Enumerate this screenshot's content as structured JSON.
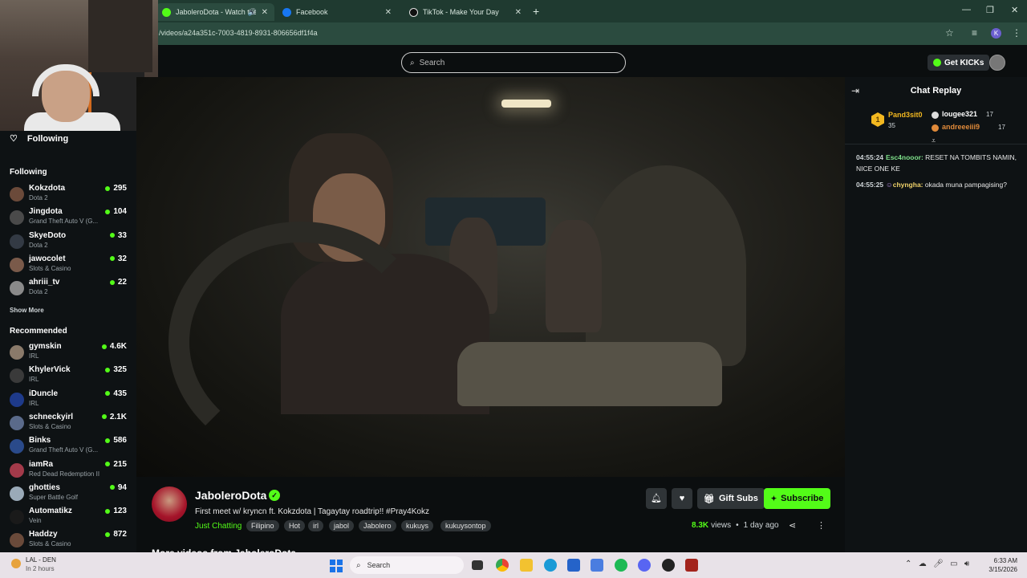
{
  "browser": {
    "tabs": [
      {
        "label": "JaboleroDota - Watch the V",
        "icon": "kick-icon",
        "active": true
      },
      {
        "label": "Facebook",
        "icon": "facebook-icon",
        "active": false
      },
      {
        "label": "TikTok - Make Your Day",
        "icon": "tiktok-icon",
        "active": false
      }
    ],
    "new_tab": "+",
    "window_controls": {
      "minimize": "—",
      "restore": "❐",
      "close": "✕"
    },
    "url": "/videos/a24a351c-7003-4819-8931-806656df1f4a",
    "profile_initial": "K"
  },
  "header": {
    "search_placeholder": "Search",
    "get_kicks_label": "Get KICKs"
  },
  "sidebar": {
    "following_nav_label": "Following",
    "following_title": "Following",
    "following": [
      {
        "name": "Kokzdota",
        "category": "Dota 2",
        "viewers": "295",
        "color": "#6b4a3a"
      },
      {
        "name": "Jingdota",
        "category": "Grand Theft Auto V (G...",
        "viewers": "104",
        "color": "#4a4a4a"
      },
      {
        "name": "SkyeDoto",
        "category": "Dota 2",
        "viewers": "33",
        "color": "#333a44"
      },
      {
        "name": "jawocolet",
        "category": "Slots & Casino",
        "viewers": "32",
        "color": "#7a5a4a"
      },
      {
        "name": "ahriii_tv",
        "category": "Dota 2",
        "viewers": "22",
        "color": "#8a8a8a"
      }
    ],
    "show_more_1": "Show More",
    "recommended_title": "Recommended",
    "recommended": [
      {
        "name": "gymskin",
        "category": "IRL",
        "viewers": "4.6K",
        "color": "#8a7a6a"
      },
      {
        "name": "KhylerVick",
        "category": "IRL",
        "viewers": "325",
        "color": "#3a3a3a"
      },
      {
        "name": "iDuncle",
        "category": "IRL",
        "viewers": "435",
        "color": "#1e3a8a"
      },
      {
        "name": "schneckyirl",
        "category": "Slots & Casino",
        "viewers": "2.1K",
        "color": "#5a6a8a"
      },
      {
        "name": "Binks",
        "category": "Grand Theft Auto V (G...",
        "viewers": "586",
        "color": "#2a4a8a"
      },
      {
        "name": "iamRa",
        "category": "Red Dead Redemption II",
        "viewers": "215",
        "color": "#a33a4a"
      },
      {
        "name": "ghotties",
        "category": "Super Battle Golf",
        "viewers": "94",
        "color": "#9aaab8"
      },
      {
        "name": "Automatikz",
        "category": "Vein",
        "viewers": "123",
        "color": "#1a1a1a"
      },
      {
        "name": "Haddzy",
        "category": "Slots & Casino",
        "viewers": "872",
        "color": "#6a4a3a"
      }
    ]
  },
  "stream": {
    "channel_name": "JaboleroDota",
    "title": "First meet w/ kryncn ft. Kokzdota | Tagaytay roadtrip!! #Pray4Kokz",
    "category": "Just Chatting",
    "tags": [
      "Filipino",
      "Hot",
      "irl",
      "jabol",
      "Jabolero",
      "kukuys",
      "kukuysontop"
    ],
    "views": "8.3K",
    "views_label": "views",
    "age": "1 day ago",
    "gift_subs_label": "Gift Subs",
    "subscribe_label": "Subscribe",
    "more_videos_heading": "More videos from JaboleroDota"
  },
  "chat": {
    "title": "Chat Replay",
    "leaderboard": {
      "rank": "1",
      "top": {
        "name": "Pand3sit0",
        "count": "35"
      },
      "second": {
        "name": "lougee321",
        "count": "17"
      },
      "third": {
        "name": "andreeeiii9",
        "count": "17"
      }
    },
    "messages": [
      {
        "time": "04:55:24",
        "user": "Esc4nooor:",
        "text": "RESET NA TOMBITS NAMIN, NICE ONE KE",
        "user_color": "#7ee08a"
      },
      {
        "time": "04:55:25",
        "user": "chyngha:",
        "text": "okada muna pampagising?",
        "user_color": "#f0d26a"
      }
    ]
  },
  "taskbar": {
    "weather_title": "LAL - DEN",
    "weather_sub": "In 2 hours",
    "search_label": "Search",
    "time": "6:33 AM",
    "date": "3/15/2026"
  },
  "colors": {
    "accent": "#53fc18",
    "background": "#0b0e0f",
    "panel": "#0e1214",
    "browser_chrome": "#1f3a30"
  }
}
